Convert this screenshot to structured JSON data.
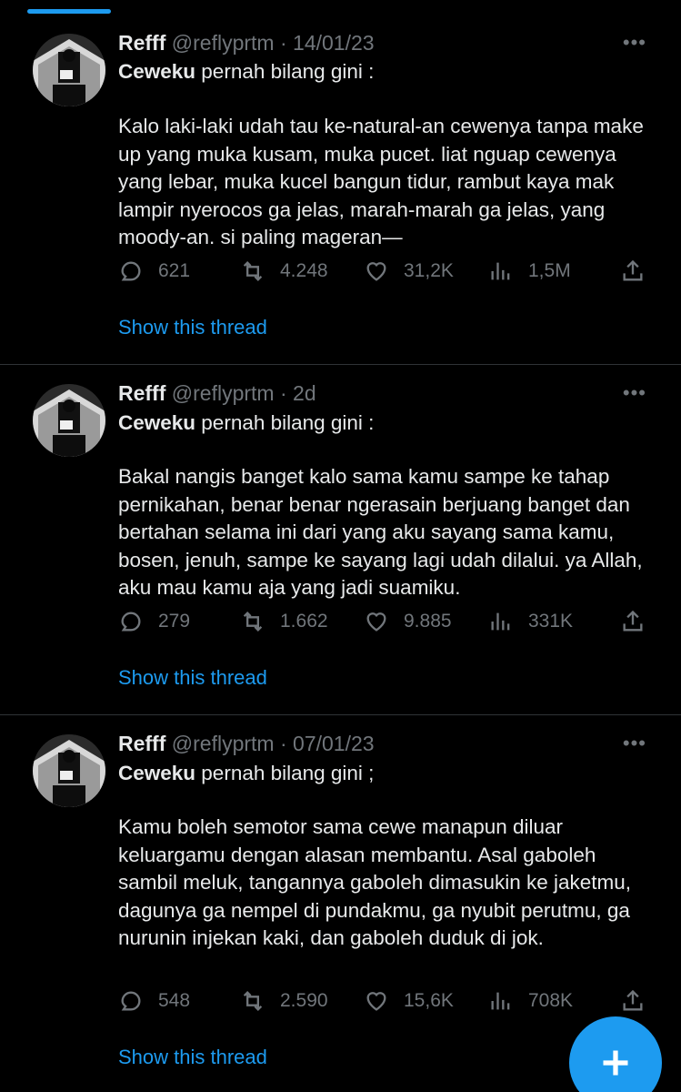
{
  "tweets": [
    {
      "name": "Refff",
      "handle": "@reflyprtm",
      "date": "· 14/01/23",
      "lead_bold": "Ceweku",
      "lead_rest": " pernah bilang gini :",
      "body": "Kalo laki-laki udah tau ke-natural-an cewenya tanpa make up yang muka kusam, muka pucet. liat nguap cewenya yang lebar, muka kucel bangun tidur, rambut kaya mak lampir nyerocos ga jelas, marah-marah ga jelas, yang moody-an. si paling mageran—",
      "replies": "621",
      "retweets": "4.248",
      "likes": "31,2K",
      "views": "1,5M",
      "show_thread": "Show this thread"
    },
    {
      "name": "Refff",
      "handle": "@reflyprtm",
      "date": "· 2d",
      "lead_bold": "Ceweku",
      "lead_rest": " pernah bilang gini :",
      "body": "Bakal nangis banget kalo sama kamu sampe ke tahap pernikahan, benar benar ngerasain berjuang banget dan bertahan selama ini dari yang aku sayang sama kamu, bosen, jenuh, sampe ke sayang lagi udah dilalui. ya Allah, aku mau kamu aja yang jadi suamiku.",
      "replies": "279",
      "retweets": "1.662",
      "likes": "9.885",
      "views": "331K",
      "show_thread": "Show this thread"
    },
    {
      "name": "Refff",
      "handle": "@reflyprtm",
      "date": "· 07/01/23",
      "lead_bold": "Ceweku",
      "lead_rest": " pernah bilang gini ;",
      "body": "Kamu boleh semotor sama cewe manapun diluar keluargamu dengan alasan membantu. Asal gaboleh sambil meluk, tangannya gaboleh dimasukin ke jaketmu, dagunya ga nempel di pundakmu, ga nyubit perutmu, ga nurunin injekan kaki, dan gaboleh duduk di jok.",
      "replies": "548",
      "retweets": "2.590",
      "likes": "15,6K",
      "views": "708K",
      "show_thread": "Show this thread"
    }
  ],
  "more_label": "•••",
  "colors": {
    "accent": "#1d9bf0",
    "muted": "#71767b",
    "text": "#e7e9ea",
    "background": "#000000"
  }
}
